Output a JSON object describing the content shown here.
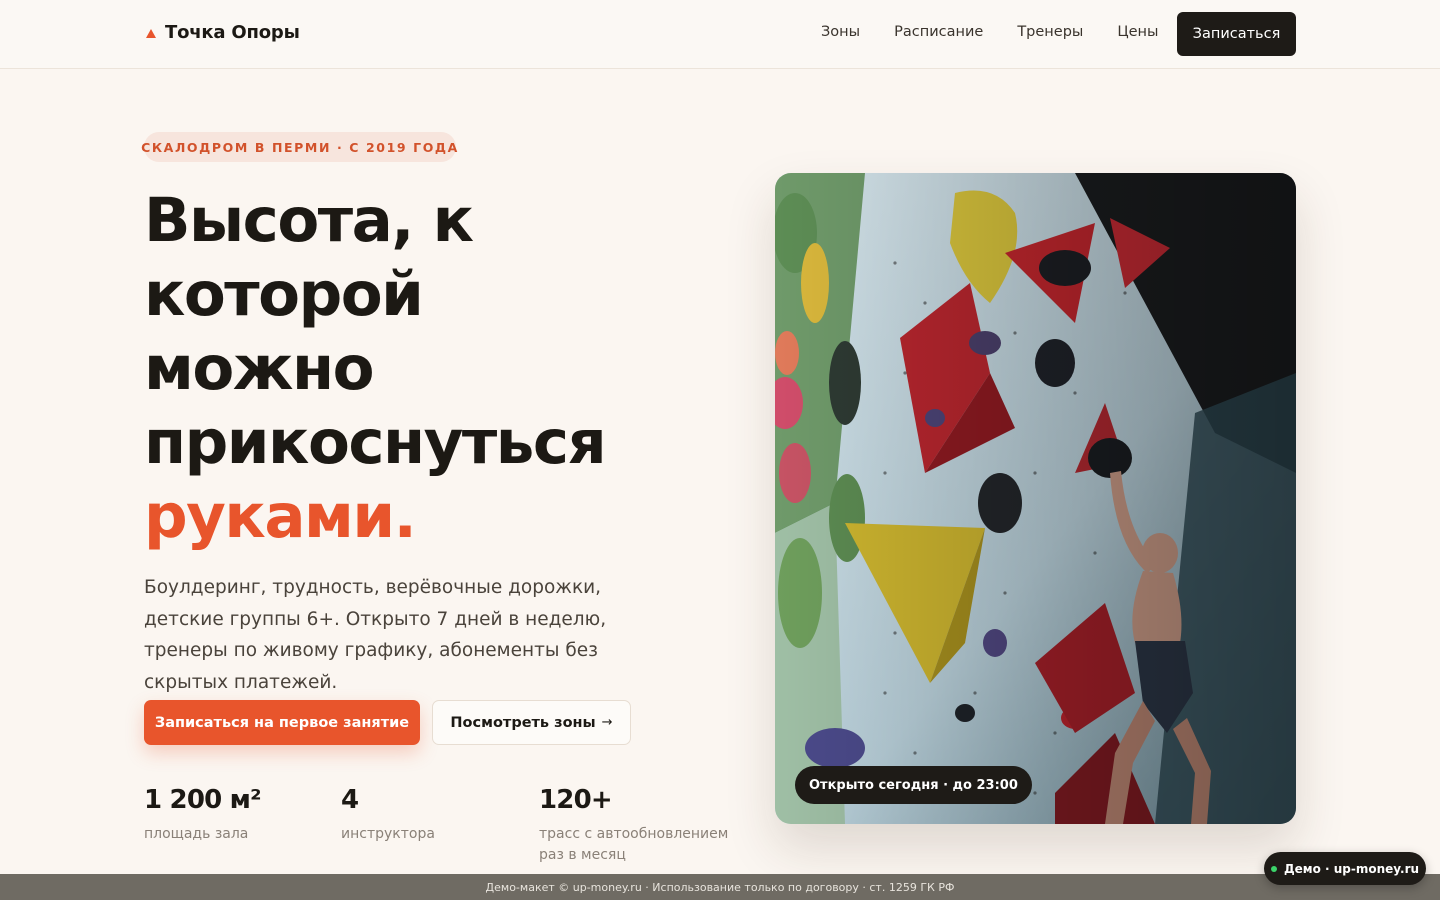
{
  "header": {
    "logo_text": "Точка Опоры",
    "nav": [
      "Зоны",
      "Расписание",
      "Тренеры",
      "Цены"
    ],
    "cta": "Записаться"
  },
  "hero": {
    "badge": "СКАЛОДРОМ В ПЕРМИ · С 2019 ГОДА",
    "headline_lines": [
      "Высота, к",
      "которой",
      "можно",
      "прикоснуться"
    ],
    "headline_accent": "руками.",
    "lead": "Боулдеринг, трудность, верёвочные дорожки, детские группы 6+. Открыто 7 дней в неделю, тренеры по живому графику, абонементы без скрытых платежей.",
    "primary_button": "Записаться на первое занятие",
    "secondary_button": "Посмотреть зоны",
    "secondary_arrow": "→",
    "image_status": "Открыто сегодня · до 23:00"
  },
  "stats": [
    {
      "value": "1 200 м²",
      "label": "площадь зала"
    },
    {
      "value": "4",
      "label": "инструктора"
    },
    {
      "value": "120+",
      "label": "трасс с автообновлением раз в месяц"
    }
  ],
  "footer": {
    "text": "Демо-макет © up-money.ru · Использование только по договору · ст. 1259 ГК РФ",
    "demo_badge": "Демо · up-money.ru"
  },
  "colors": {
    "accent": "#e8552c",
    "dark": "#1e1b17",
    "background": "#fbf6f1"
  }
}
